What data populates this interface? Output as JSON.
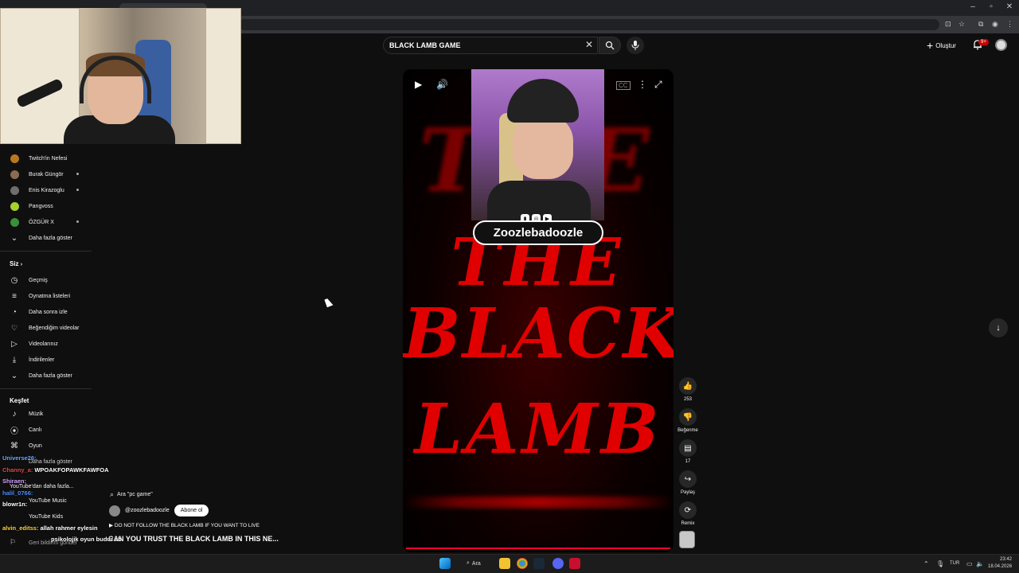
{
  "browser": {
    "tabs": [
      "",
      ""
    ],
    "window_controls": [
      "–",
      "▫",
      "✕"
    ]
  },
  "youtube": {
    "search": {
      "query": "BLACK LAMB GAME"
    },
    "create_label": "Oluştur",
    "notification_badge": "9+"
  },
  "sidebar": {
    "subscriptions": [
      {
        "label": "Twitch'in Nefesi",
        "color": "#b7781e",
        "live": false
      },
      {
        "label": "Burak Güngör",
        "color": "#8c6a52",
        "live": true
      },
      {
        "label": "Enis Kirazoglu",
        "color": "#6e6e6e",
        "live": true
      },
      {
        "label": "Pangvoss",
        "color": "#a7d02b",
        "live": false
      },
      {
        "label": "ÖZGÜR X",
        "color": "#3a8f3a",
        "live": true
      }
    ],
    "show_more_1": "Daha fazla göster",
    "you_heading": "Siz",
    "you_items": [
      {
        "label": "Geçmiş",
        "icon": "history-icon",
        "glyph": "◷"
      },
      {
        "label": "Oynatma listeleri",
        "icon": "playlist-icon",
        "glyph": "≡"
      },
      {
        "label": "Daha sonra izle",
        "icon": "clock-icon",
        "glyph": "◔"
      },
      {
        "label": "Beğendiğim videolar",
        "icon": "thumbs-up-icon",
        "glyph": "👍"
      },
      {
        "label": "Videolarınız",
        "icon": "your-videos-icon",
        "glyph": "▷"
      },
      {
        "label": "İndirilenler",
        "icon": "download-icon",
        "glyph": "⤓"
      }
    ],
    "show_more_2": "Daha fazla göster",
    "explore_heading": "Keşfet",
    "explore_items": [
      {
        "label": "Müzik",
        "icon": "music-icon",
        "glyph": "♪"
      },
      {
        "label": "Canlı",
        "icon": "live-icon",
        "glyph": "⦿"
      },
      {
        "label": "Oyun",
        "icon": "gaming-icon",
        "glyph": "⌘"
      }
    ]
  },
  "player": {
    "title_words": [
      "THE",
      "THE",
      "BLACK",
      "LAMB"
    ],
    "creator_overlay": "Zoozlebadoozle"
  },
  "actions": {
    "like_count": "253",
    "dislike_label": "Beğenme",
    "comment_count": "17",
    "share_label": "Paylaş",
    "remix_label": "Remix"
  },
  "short_info": {
    "search_chip": "Ara \"pc game\"",
    "channel": "@zoozlebadoozle",
    "subscribe": "Abone ol",
    "description": "DO NOT FOLLOW THE BLACK LAMB IF YOU WANT TO LIVE",
    "title": "CAN YOU TRUST THE BLACK LAMB IN THIS NE..."
  },
  "chat": [
    {
      "user": "Universe26:",
      "msg": "",
      "color": "#6aa5ff"
    },
    {
      "user": "Channy_a:",
      "msg": "WPOAKFOPAWKFAWFOA",
      "color": "#d84a4a"
    },
    {
      "user": "Shiraen:",
      "msg": "",
      "color": "#d0a0ff"
    },
    {
      "user": "halil_0766:",
      "msg": "",
      "color": "#4a8cff"
    },
    {
      "user": "blowr1n:",
      "msg": "",
      "color": "#ffffff"
    },
    {
      "user": "alvin_editss:",
      "msg": "allah rahmer eylesin",
      "color": "#ffd23a"
    },
    {
      "user": "",
      "msg": "psikolojik oyun budur ab",
      "color": "#7fb0ff"
    }
  ],
  "sidebar_bottom": {
    "show_more": "Daha fazla göster",
    "youtube_more": "YouTube'dan daha fazla...",
    "youtube_music": "YouTube Music",
    "youtube_kids": "YouTube Kids",
    "report": "Geri bildirim gönder"
  },
  "taskbar": {
    "search_label": "Ara",
    "lang": "TUR",
    "time": "23:42",
    "date": "18.04.2026"
  }
}
